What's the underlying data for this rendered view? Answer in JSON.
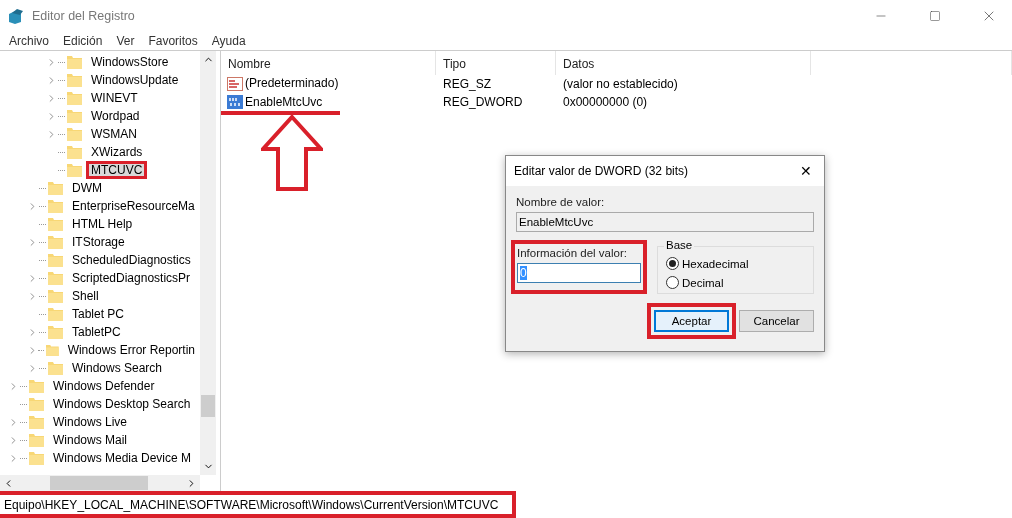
{
  "window": {
    "title": "Editor del Registro"
  },
  "menu": [
    "Archivo",
    "Edición",
    "Ver",
    "Favoritos",
    "Ayuda"
  ],
  "tree": {
    "items": [
      {
        "children": [
          {
            "children": [
              {
                "label": "WindowsStore",
                "expandable": true,
                "selected": false,
                "highlighted": false
              },
              {
                "label": "WindowsUpdate",
                "expandable": true,
                "selected": false,
                "highlighted": false
              },
              {
                "label": "WINEVT",
                "expandable": true,
                "selected": false,
                "highlighted": false
              },
              {
                "label": "Wordpad",
                "expandable": true,
                "selected": false,
                "highlighted": false
              },
              {
                "label": "WSMAN",
                "expandable": true,
                "selected": false,
                "highlighted": false
              },
              {
                "label": "XWizards",
                "expandable": false,
                "selected": false,
                "highlighted": false
              },
              {
                "label": "MTCUVC",
                "expandable": false,
                "selected": true,
                "highlighted": true
              }
            ]
          },
          {
            "label": "DWM",
            "expandable": false,
            "selected": false,
            "highlighted": false
          },
          {
            "label": "EnterpriseResourceMa",
            "expandable": true,
            "selected": false,
            "highlighted": false
          },
          {
            "label": "HTML Help",
            "expandable": false,
            "selected": false,
            "highlighted": false
          },
          {
            "label": "ITStorage",
            "expandable": true,
            "selected": false,
            "highlighted": false
          },
          {
            "label": "ScheduledDiagnostics",
            "expandable": false,
            "selected": false,
            "highlighted": false
          },
          {
            "label": "ScriptedDiagnosticsPr",
            "expandable": true,
            "selected": false,
            "highlighted": false
          },
          {
            "label": "Shell",
            "expandable": true,
            "selected": false,
            "highlighted": false
          },
          {
            "label": "Tablet PC",
            "expandable": false,
            "selected": false,
            "highlighted": false
          },
          {
            "label": "TabletPC",
            "expandable": true,
            "selected": false,
            "highlighted": false
          },
          {
            "label": "Windows Error Reportin",
            "expandable": true,
            "selected": false,
            "highlighted": false
          },
          {
            "label": "Windows Search",
            "expandable": true,
            "selected": false,
            "highlighted": false
          }
        ]
      },
      {
        "label": "Windows Defender",
        "expandable": true,
        "selected": false,
        "highlighted": false
      },
      {
        "label": "Windows Desktop Search",
        "expandable": false,
        "selected": false,
        "highlighted": false
      },
      {
        "label": "Windows Live",
        "expandable": true,
        "selected": false,
        "highlighted": false
      },
      {
        "label": "Windows Mail",
        "expandable": true,
        "selected": false,
        "highlighted": false
      },
      {
        "label": "Windows Media Device M",
        "expandable": true,
        "selected": false,
        "highlighted": false
      }
    ]
  },
  "values": {
    "columns": [
      "Nombre",
      "Tipo",
      "Datos"
    ],
    "rows": [
      {
        "kind": "string",
        "name": "(Predeterminado)",
        "type": "REG_SZ",
        "data": "(valor no establecido)",
        "underlined": false,
        "arrow": false
      },
      {
        "kind": "binary",
        "name": "EnableMtcUvc",
        "type": "REG_DWORD",
        "data": "0x00000000 (0)",
        "underlined": true,
        "arrow": true
      }
    ]
  },
  "dialog": {
    "title": "Editar valor de DWORD (32 bits)",
    "close": "✕",
    "name_label": "Nombre de valor:",
    "name_value": "EnableMtcUvc",
    "data_label": "Información del valor:",
    "data_value": "0",
    "data_highlighted": true,
    "base_label": "Base",
    "radios": [
      {
        "label": "Hexadecimal",
        "selected": true
      },
      {
        "label": "Decimal",
        "selected": false
      }
    ],
    "buttons": [
      {
        "label": "Aceptar",
        "default": true,
        "highlighted": true
      },
      {
        "label": "Cancelar",
        "default": false,
        "highlighted": false
      }
    ]
  },
  "status_bar": {
    "path": "Equipo\\HKEY_LOCAL_MACHINE\\SOFTWARE\\Microsoft\\Windows\\CurrentVersion\\MTCUVC",
    "highlighted": true
  }
}
